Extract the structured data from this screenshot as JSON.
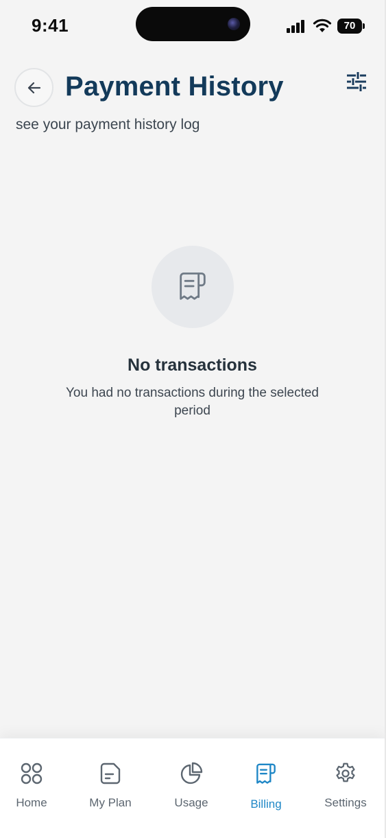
{
  "status_bar": {
    "time": "9:41",
    "battery": "70",
    "icons": [
      "signal-icon",
      "wifi-icon",
      "battery-icon"
    ]
  },
  "header": {
    "title": "Payment History",
    "subtitle": "see your payment history log",
    "back_icon": "arrow-left-icon",
    "filter_icon": "sliders-icon"
  },
  "empty_state": {
    "icon": "receipt-icon",
    "title": "No transactions",
    "message": "You had no transactions during the selected period"
  },
  "tab_bar": {
    "items": [
      {
        "label": "Home",
        "icon": "grid-icon",
        "active": false
      },
      {
        "label": "My Plan",
        "icon": "document-icon",
        "active": false
      },
      {
        "label": "Usage",
        "icon": "pie-chart-icon",
        "active": false
      },
      {
        "label": "Billing",
        "icon": "receipt-icon",
        "active": true
      },
      {
        "label": "Settings",
        "icon": "gear-icon",
        "active": false
      }
    ]
  },
  "colors": {
    "title": "#133a5a",
    "accent": "#1f87c6",
    "background": "#f4f4f4",
    "tab_inactive": "#5c6670"
  }
}
